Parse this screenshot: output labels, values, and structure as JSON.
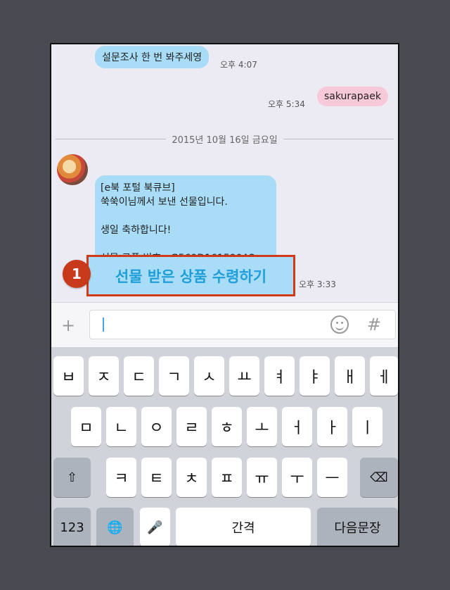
{
  "messages": {
    "msg1": {
      "text": "설문조사 한 번 봐주세영",
      "time": "오후 4:07"
    },
    "msg2": {
      "text": "sakurapaek",
      "time": "오후 5:34"
    },
    "date_divider": "2015년 10월 16일 금요일",
    "gift": {
      "lines": [
        "[e북 포털 북큐브]",
        "쑥쑥이님께서 보낸 선물입니다.",
        "생일 축하합니다!",
        "선물 쿠폰 번호 : G569D161590A2"
      ],
      "time": "오후 3:33",
      "receive_label": "선물 받은 상품 수령하기"
    }
  },
  "annotation": {
    "marker": "1",
    "color": "#d1391b"
  },
  "input": {
    "plus": "+",
    "hash": "#"
  },
  "keyboard": {
    "row1": [
      "ㅂ",
      "ㅈ",
      "ㄷ",
      "ㄱ",
      "ㅅ",
      "ㅛ",
      "ㅕ",
      "ㅑ",
      "ㅐ",
      "ㅔ"
    ],
    "row2": [
      "ㅁ",
      "ㄴ",
      "ㅇ",
      "ㄹ",
      "ㅎ",
      "ㅗ",
      "ㅓ",
      "ㅏ",
      "ㅣ"
    ],
    "row3": [
      "ㅋ",
      "ㅌ",
      "ㅊ",
      "ㅍ",
      "ㅠ",
      "ㅜ",
      "ㅡ"
    ],
    "shift_icon": "⇧",
    "delete_icon": "⌫",
    "numbers": "123",
    "globe_icon": "🌐",
    "mic_icon": "🎤",
    "space": "간격",
    "return": "다음문장"
  }
}
